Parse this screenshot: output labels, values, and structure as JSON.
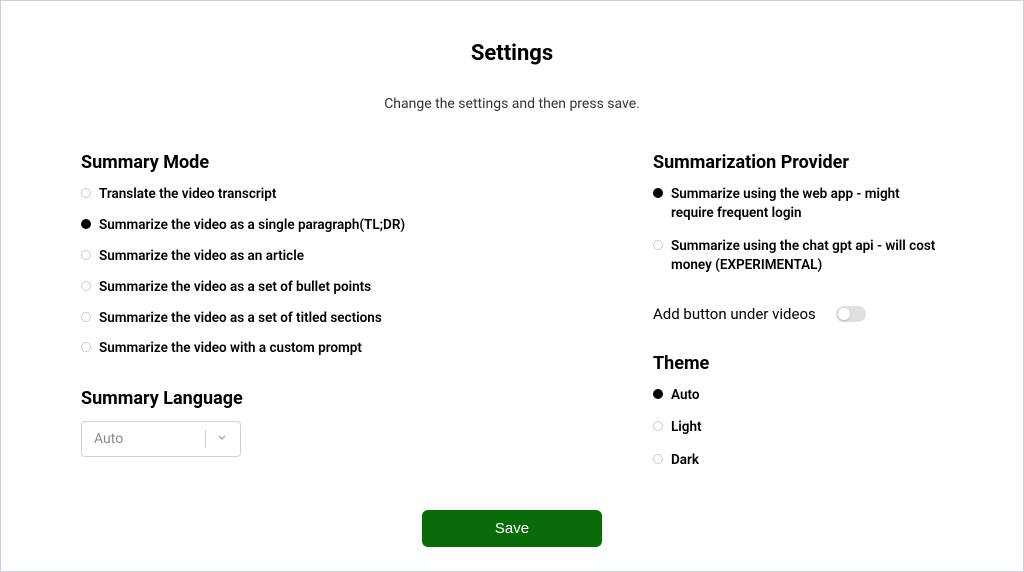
{
  "title": "Settings",
  "subtitle": "Change the settings and then press save.",
  "summaryMode": {
    "title": "Summary Mode",
    "options": [
      {
        "label": "Translate the video transcript",
        "selected": false
      },
      {
        "label": "Summarize the video as a single paragraph(TL;DR)",
        "selected": true
      },
      {
        "label": "Summarize the video as an article",
        "selected": false
      },
      {
        "label": "Summarize the video as a set of bullet points",
        "selected": false
      },
      {
        "label": "Summarize the video as a set of titled sections",
        "selected": false
      },
      {
        "label": "Summarize the video with a custom prompt",
        "selected": false
      }
    ]
  },
  "summaryLanguage": {
    "title": "Summary Language",
    "value": "Auto"
  },
  "provider": {
    "title": "Summarization Provider",
    "options": [
      {
        "label": "Summarize using the web app - might require frequent login",
        "selected": true
      },
      {
        "label": "Summarize using the chat gpt api - will cost money (EXPERIMENTAL)",
        "selected": false
      }
    ]
  },
  "addButton": {
    "label": "Add button under videos",
    "value": false
  },
  "theme": {
    "title": "Theme",
    "options": [
      {
        "label": "Auto",
        "selected": true
      },
      {
        "label": "Light",
        "selected": false
      },
      {
        "label": "Dark",
        "selected": false
      }
    ]
  },
  "saveLabel": "Save"
}
